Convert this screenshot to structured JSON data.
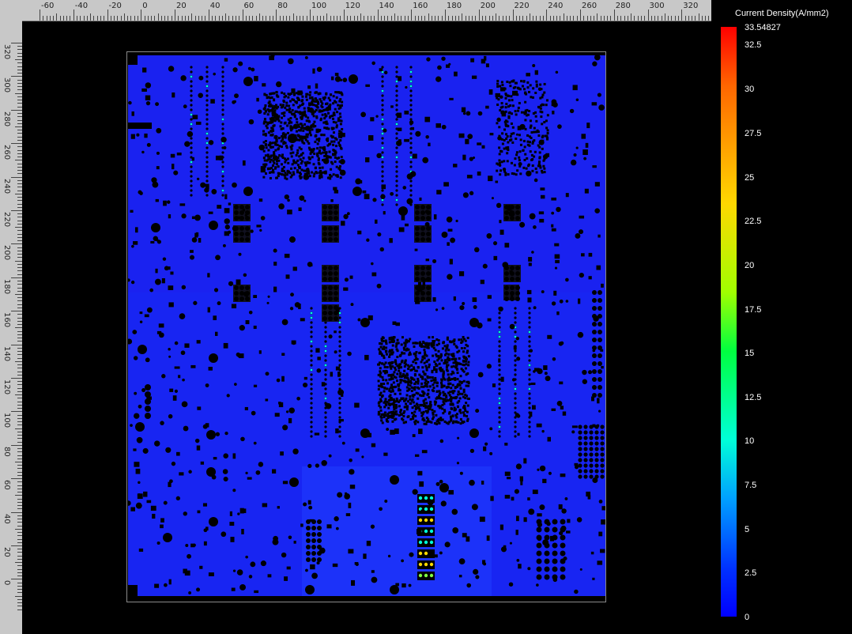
{
  "ruler": {
    "x_ticks": [
      "-60",
      "-40",
      "-20",
      "0",
      "20",
      "40",
      "60",
      "80",
      "100",
      "120",
      "140",
      "160",
      "180",
      "200",
      "220",
      "240",
      "260",
      "280",
      "300",
      "320"
    ],
    "y_ticks": [
      "320",
      "300",
      "280",
      "260",
      "240",
      "220",
      "200",
      "180",
      "160",
      "140",
      "120",
      "100",
      "80",
      "60",
      "40",
      "20",
      "0"
    ]
  },
  "legend": {
    "title": "Current Density(A/mm2)",
    "max_value": "33.54827",
    "labels": [
      "32.5",
      "30",
      "27.5",
      "25",
      "22.5",
      "20",
      "17.5",
      "15",
      "12.5",
      "10",
      "7.5",
      "5",
      "2.5",
      "0"
    ]
  },
  "colors": {
    "board_fill": "#1a22f0",
    "hole": "#000000",
    "hotspot_low": "#00ffd8",
    "hotspot_mid": "#ffd800",
    "hotspot_high": "#ff3000"
  },
  "icons": [
    "via-hole-icon",
    "pad-icon",
    "bga-array-icon"
  ]
}
